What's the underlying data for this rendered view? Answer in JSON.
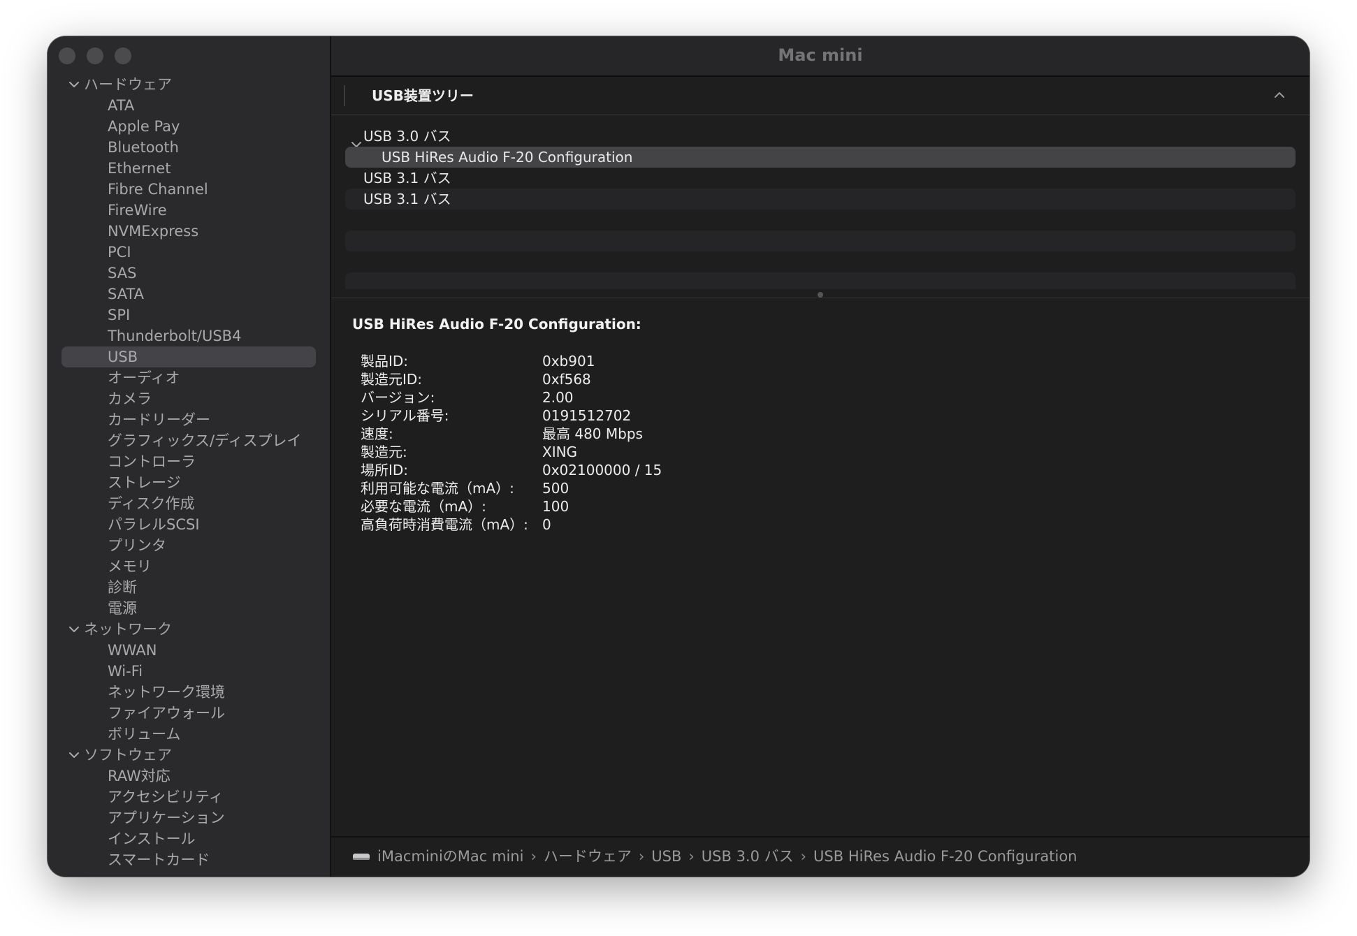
{
  "window": {
    "title": "Mac mini"
  },
  "sidebar": {
    "sections": [
      {
        "label": "ハードウェア",
        "items": [
          "ATA",
          "Apple Pay",
          "Bluetooth",
          "Ethernet",
          "Fibre Channel",
          "FireWire",
          "NVMExpress",
          "PCI",
          "SAS",
          "SATA",
          "SPI",
          "Thunderbolt/USB4",
          "USB",
          "オーディオ",
          "カメラ",
          "カードリーダー",
          "グラフィックス/ディスプレイ",
          "コントローラ",
          "ストレージ",
          "ディスク作成",
          "パラレルSCSI",
          "プリンタ",
          "メモリ",
          "診断",
          "電源"
        ]
      },
      {
        "label": "ネットワーク",
        "items": [
          "WWAN",
          "Wi-Fi",
          "ネットワーク環境",
          "ファイアウォール",
          "ボリューム"
        ]
      },
      {
        "label": "ソフトウェア",
        "items": [
          "RAW対応",
          "アクセシビリティ",
          "アプリケーション",
          "インストール",
          "スマートカード"
        ]
      }
    ],
    "selected": "USB"
  },
  "tree": {
    "header": "USB装置ツリー",
    "rows": [
      {
        "label": "USB 3.0 バス",
        "level": 0,
        "expanded": true
      },
      {
        "label": "USB HiRes Audio F-20 Configuration",
        "level": 1,
        "selected": true
      },
      {
        "label": "USB 3.1 バス",
        "level": 0
      },
      {
        "label": "USB 3.1 バス",
        "level": 0
      }
    ]
  },
  "detail": {
    "title": "USB HiRes Audio F-20 Configuration:",
    "props": [
      {
        "key": "製品ID:",
        "value": "0xb901"
      },
      {
        "key": "製造元ID:",
        "value": "0xf568"
      },
      {
        "key": "バージョン:",
        "value": "2.00"
      },
      {
        "key": "シリアル番号:",
        "value": "0191512702"
      },
      {
        "key": "速度:",
        "value": "最高 480 Mbps"
      },
      {
        "key": "製造元:",
        "value": "XING"
      },
      {
        "key": "場所ID:",
        "value": "0x02100000 / 15"
      },
      {
        "key": "利用可能な電流（mA）:",
        "value": "500"
      },
      {
        "key": "必要な電流（mA）:",
        "value": "100"
      },
      {
        "key": "高負荷時消費電流（mA）:",
        "value": "0"
      }
    ]
  },
  "pathbar": {
    "segments": [
      "iMacminiのMac mini",
      "ハードウェア",
      "USB",
      "USB 3.0 バス",
      "USB HiRes Audio F-20 Configuration"
    ]
  },
  "colors": {
    "window_bg": "#1e1e1e",
    "sidebar_bg": "#2a2a2c",
    "selection": "#444446"
  }
}
